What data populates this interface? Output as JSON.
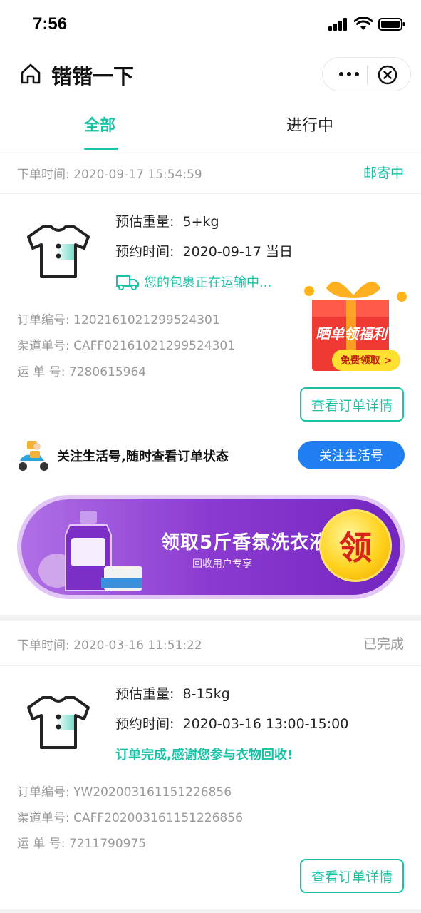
{
  "status_bar": {
    "time": "7:56"
  },
  "nav": {
    "title": "锴锴一下"
  },
  "tabs": [
    {
      "label": "全部",
      "active": true
    },
    {
      "label": "进行中",
      "active": false
    }
  ],
  "orders": [
    {
      "time_label": "下单时间:",
      "time_value": "2020-09-17 15:54:59",
      "status": "邮寄中",
      "weight_label": "预估重量:",
      "weight_value": "5+kg",
      "appt_label": "预约时间:",
      "appt_value": "2020-09-17 当日",
      "message": "您的包裹正在运输中...",
      "order_no_label": "订单编号:",
      "order_no": "1202161021299524301",
      "channel_no_label": "渠道单号:",
      "channel_no": "CAFF02161021299524301",
      "waybill_label": "运 单 号:",
      "waybill": "7280615964",
      "detail_button": "查看订单详情"
    },
    {
      "time_label": "下单时间:",
      "time_value": "2020-03-16 11:51:22",
      "status": "已完成",
      "weight_label": "预估重量:",
      "weight_value": "8-15kg",
      "appt_label": "预约时间:",
      "appt_value": "2020-03-16 13:00-15:00",
      "message": "订单完成,感谢您参与衣物回收!",
      "order_no_label": "订单编号:",
      "order_no": "YW202003161151226856",
      "channel_no_label": "渠道单号:",
      "channel_no": "CAFF202003161151226856",
      "waybill_label": "运 单 号:",
      "waybill": "7211790975",
      "detail_button": "查看订单详情"
    }
  ],
  "gift": {
    "title": "晒单领福利",
    "button": "免费领取 >"
  },
  "follow": {
    "text": "关注生活号,随时查看订单状态",
    "button": "关注生活号"
  },
  "promo": {
    "title": "领取5斤香氛洗衣液",
    "subtitle": "回收用户专享",
    "badge": "领"
  },
  "colors": {
    "accent": "#19c2a5",
    "blue_button": "#1e7ef2",
    "promo_purple": "#8a3ad0",
    "badge_yellow": "#ffd21e"
  }
}
